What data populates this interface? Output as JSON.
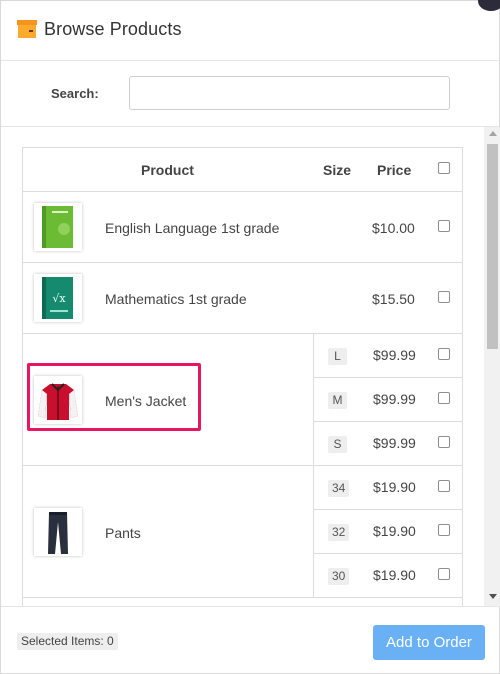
{
  "header": {
    "title": "Browse Products",
    "icon": "box-icon"
  },
  "search": {
    "label": "Search:",
    "value": "",
    "placeholder": ""
  },
  "table": {
    "headers": {
      "product": "Product",
      "size": "Size",
      "price": "Price"
    },
    "rows": [
      {
        "name": "English Language 1st grade",
        "price": "$10.00",
        "image": "green-book-image"
      },
      {
        "name": "Mathematics 1st grade",
        "price": "$15.50",
        "image": "teal-math-book-image"
      },
      {
        "name": "Men's Jacket",
        "image": "red-jacket-image",
        "variants": [
          {
            "size": "L",
            "price": "$99.99"
          },
          {
            "size": "M",
            "price": "$99.99"
          },
          {
            "size": "S",
            "price": "$99.99"
          }
        ]
      },
      {
        "name": "Pants",
        "image": "dark-pants-image",
        "variants": [
          {
            "size": "34",
            "price": "$19.90"
          },
          {
            "size": "32",
            "price": "$19.90"
          },
          {
            "size": "30",
            "price": "$19.90"
          }
        ]
      }
    ]
  },
  "footer": {
    "selected_items": "Selected Items: 0",
    "add_button": "Add to Order"
  },
  "colors": {
    "highlight": "#e8155f",
    "button": "#6ab0f5",
    "badge_bg": "#eeeeee"
  }
}
